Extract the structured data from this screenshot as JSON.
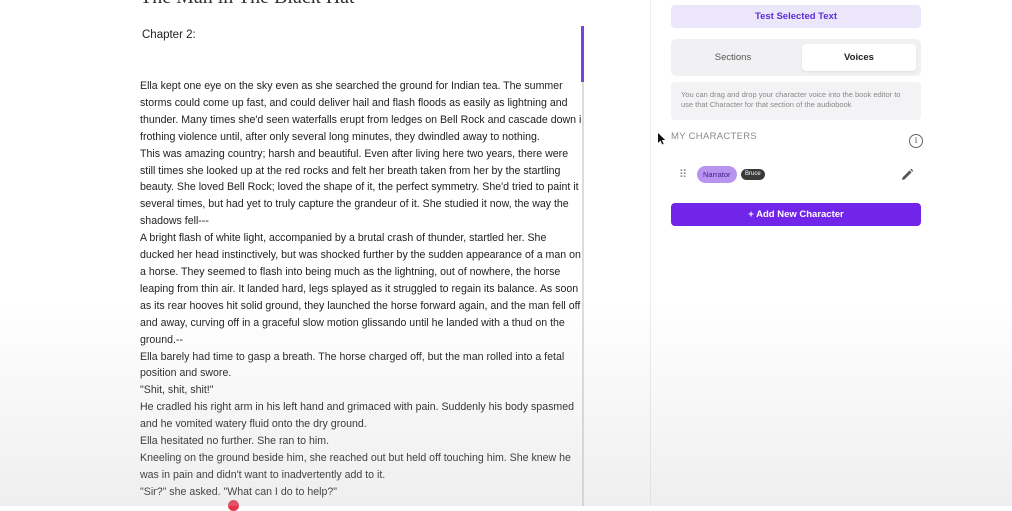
{
  "editor": {
    "book_title": "The Man in The Black Hat",
    "chapter_heading": "Chapter 2:",
    "lines": [
      " Ella kept one eye on the sky even as she searched the ground for Indian tea. The summer",
      "storms could come up fast, and could deliver hail and flash floods as easily as lightning and",
      "thunder. Many times she'd seen waterfalls erupt from ledges on Bell Rock and cascade down in",
      "frothing violence until, after only several long minutes, they dwindled away to nothing.",
      " This was amazing country; harsh and beautiful. Even after living here two years, there were",
      "still times she looked up at the red rocks and felt her breath taken from her by the startling",
      "beauty. She loved Bell Rock; loved the shape of it, the perfect symmetry. She'd tried to paint it",
      "several times, but had yet to truly capture the grandeur of it. She studied it now, the way the",
      "shadows fell---",
      " A bright flash of white light, accompanied by a brutal crash of thunder, startled her. She",
      "ducked her head instinctively, but was shocked further by the sudden appearance of a man on",
      "a horse. They seemed to flash into being much as the lightning, out of nowhere, the horse",
      "leaping from thin air. It landed hard, legs splayed as it struggled to regain its balance. As soon",
      "as its rear hooves hit solid ground, they launched the horse forward again, and the man fell off",
      "and away, curving off in a graceful slow motion glissando until he landed with a thud on the",
      "ground.--",
      " Ella barely had time to gasp a breath. The horse charged off, but the man rolled into a fetal",
      "position and swore.",
      " \"Shit, shit, shit!\"",
      " He cradled his right arm in his left hand and grimaced with pain. Suddenly his body spasmed",
      "and he vomited watery fluid onto the dry ground.",
      " Ella hesitated no further. She ran to him.",
      " Kneeling on the ground beside him, she reached out but held off touching him. She knew he",
      "was in pain and didn't want to inadvertently add to it.",
      " \"Sir?\" she asked. \"What can I do to help?\""
    ]
  },
  "sidebar": {
    "test_button": "Test Selected Text",
    "tabs": {
      "sections": "Sections",
      "voices": "Voices"
    },
    "help_text": "You can drag and drop your character voice into the book editor to use that Character for that section of the audiobook",
    "characters_heading": "MY CHARACTERS",
    "characters": [
      {
        "name": "Narrator",
        "voice": "Bruce"
      }
    ],
    "add_button": "+ Add New Character"
  },
  "colors": {
    "accent": "#7125e8",
    "accent_light": "#ece6fb",
    "narrator_pill": "#b893f0"
  }
}
